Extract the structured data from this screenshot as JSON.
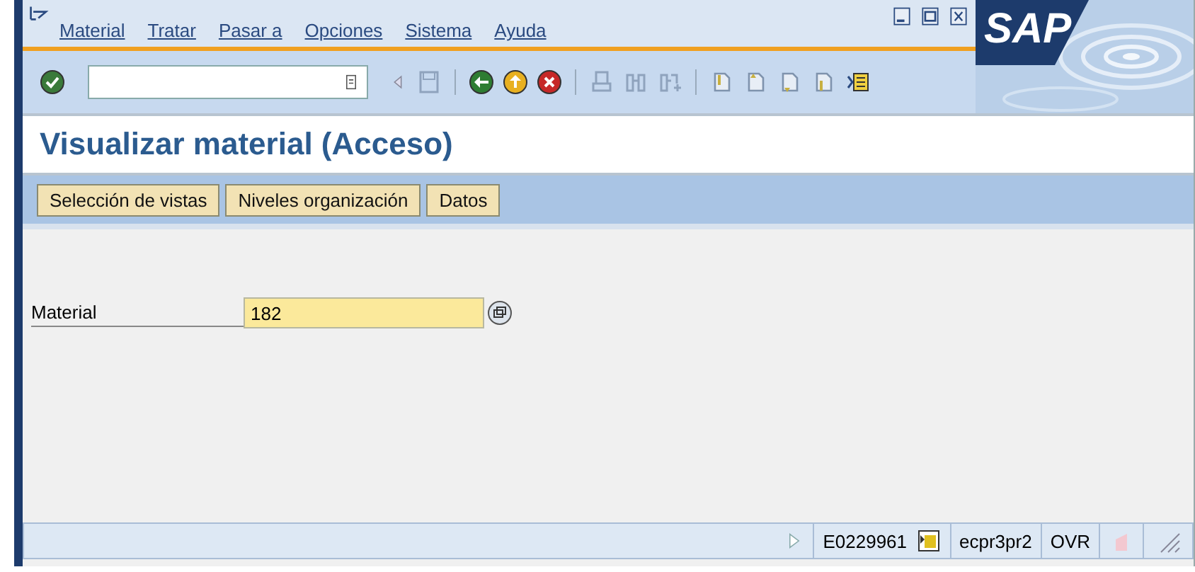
{
  "menu": [
    {
      "label": "Material"
    },
    {
      "label": "Tratar"
    },
    {
      "label": "Pasar a"
    },
    {
      "label": "Opciones"
    },
    {
      "label": "Sistema"
    },
    {
      "label": "Ayuda"
    }
  ],
  "logo": "SAP",
  "title": "Visualizar material (Acceso)",
  "buttons": [
    "Selección de vistas",
    "Niveles organización",
    "Datos"
  ],
  "field": {
    "label": "Material",
    "value": "182"
  },
  "status_bar": {
    "system": "E0229961",
    "server": "ecpr3pr2",
    "mode": "OVR"
  }
}
